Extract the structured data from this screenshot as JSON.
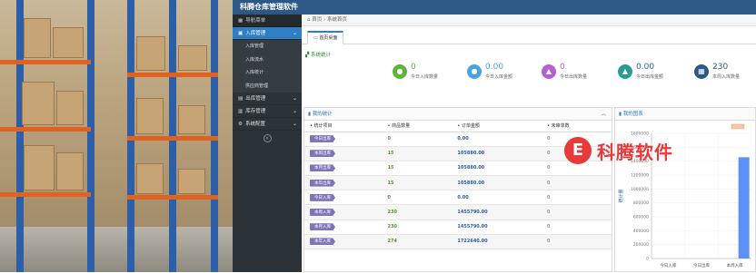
{
  "app": {
    "title": "科腾仓库管理软件"
  },
  "sidebar": {
    "header": "导航菜单",
    "items": [
      {
        "label": "入库管理",
        "active": true,
        "children": [
          "入库管理",
          "入库流水",
          "入库统计",
          "供应商管理"
        ]
      },
      {
        "label": "出库管理"
      },
      {
        "label": "库存管理"
      },
      {
        "label": "系统配置"
      }
    ]
  },
  "breadcrumb": {
    "home": "首页",
    "current": "系统首页"
  },
  "tabs": [
    {
      "label": "首页桌面"
    }
  ],
  "stats_section": {
    "title": "系统统计"
  },
  "stats": [
    {
      "value": "0",
      "label": "今日入库数量",
      "color": "#5fb43a",
      "icon": "chat-icon"
    },
    {
      "value": "0.00",
      "label": "今日入库金额",
      "color": "#4aa3df",
      "icon": "message-icon"
    },
    {
      "value": "0",
      "label": "今日出库数量",
      "color": "#b55fd0",
      "icon": "flask-icon"
    },
    {
      "value": "0.00",
      "label": "今日出库金额",
      "color": "#2e9b9b",
      "icon": "beaker-icon"
    },
    {
      "value": "230",
      "label": "本周入库数量",
      "color": "#2b5885",
      "icon": "calendar-icon"
    }
  ],
  "table_panel": {
    "title": "我的统计",
    "columns": [
      "统计项目",
      "商品数量",
      "订单金额",
      "未审单数"
    ],
    "rows": [
      {
        "item": "今日出库",
        "qty": "0",
        "amount": "0.00",
        "pending": "0"
      },
      {
        "item": "本周出库",
        "qty": "15",
        "amount": "105880.00",
        "pending": "0"
      },
      {
        "item": "本月出库",
        "qty": "15",
        "amount": "105880.00",
        "pending": "0"
      },
      {
        "item": "本年出库",
        "qty": "15",
        "amount": "105880.00",
        "pending": "0"
      },
      {
        "item": "今日入库",
        "qty": "0",
        "amount": "0.00",
        "pending": "0"
      },
      {
        "item": "本周入库",
        "qty": "230",
        "amount": "1455790.00",
        "pending": "0"
      },
      {
        "item": "本月入库",
        "qty": "230",
        "amount": "1455790.00",
        "pending": "0"
      },
      {
        "item": "本年入库",
        "qty": "274",
        "amount": "1722640.00",
        "pending": "0"
      }
    ]
  },
  "chart_panel": {
    "title": "我的图表",
    "ylabel": "统计量"
  },
  "chart_data": {
    "type": "bar",
    "categories": [
      "今日入库",
      "今日出库",
      "本周入库"
    ],
    "values": [
      0,
      0,
      1455790
    ],
    "ylim": [
      0,
      1800000
    ],
    "yticks": [
      "0",
      "200000",
      "400000",
      "600000",
      "800000",
      "1000000",
      "1200000",
      "1400000",
      "1600000",
      "1800000"
    ],
    "bar_color": "#5b8ff9",
    "legend_color": "#f6c8a0"
  },
  "watermark": {
    "logo": "E",
    "text": "科腾软件"
  }
}
